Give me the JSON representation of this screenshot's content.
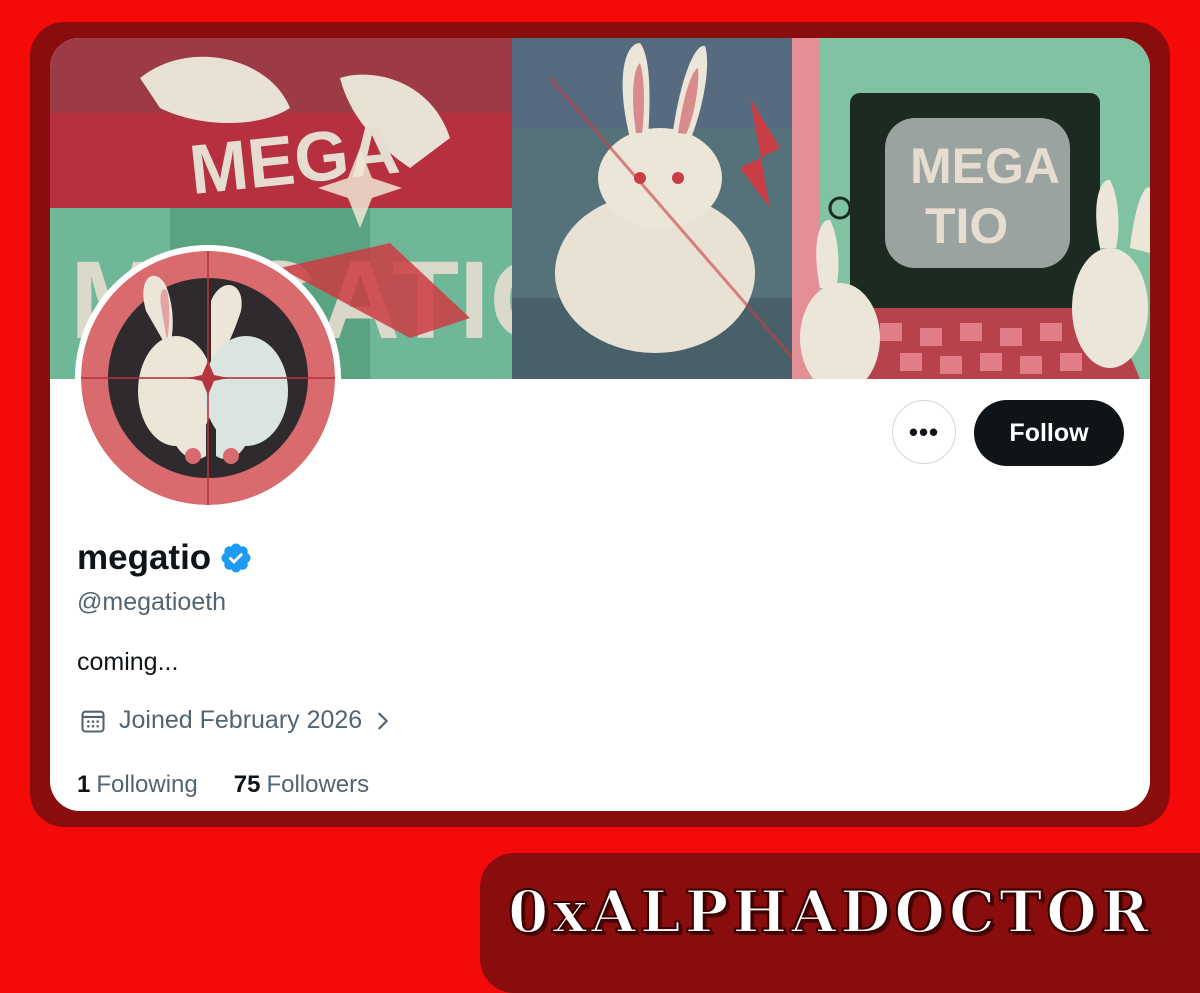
{
  "profile": {
    "display_name": "megatio",
    "handle": "@megatioeth",
    "bio": "coming...",
    "joined": "Joined February 2026",
    "following_count": "1",
    "following_label": "Following",
    "followers_count": "75",
    "followers_label": "Followers",
    "verified": true
  },
  "actions": {
    "more_label": "•••",
    "follow_label": "Follow"
  },
  "banner": {
    "panel_text_left_top": "MEGA",
    "panel_text_left_bottom": "MEGATIO",
    "panel_text_right": "MEGA TIO"
  },
  "watermark": {
    "text": "0xALPHADOCTOR"
  },
  "colors": {
    "background": "#f50a0a",
    "frame": "#8a0d0d",
    "follow_button": "#0f1419",
    "verified": "#1d9bf0",
    "muted_text": "#536471"
  },
  "icons": {
    "verified": "verified-badge-icon",
    "calendar": "calendar-icon",
    "chevron": "chevron-right-icon",
    "more": "more-dots-icon"
  }
}
